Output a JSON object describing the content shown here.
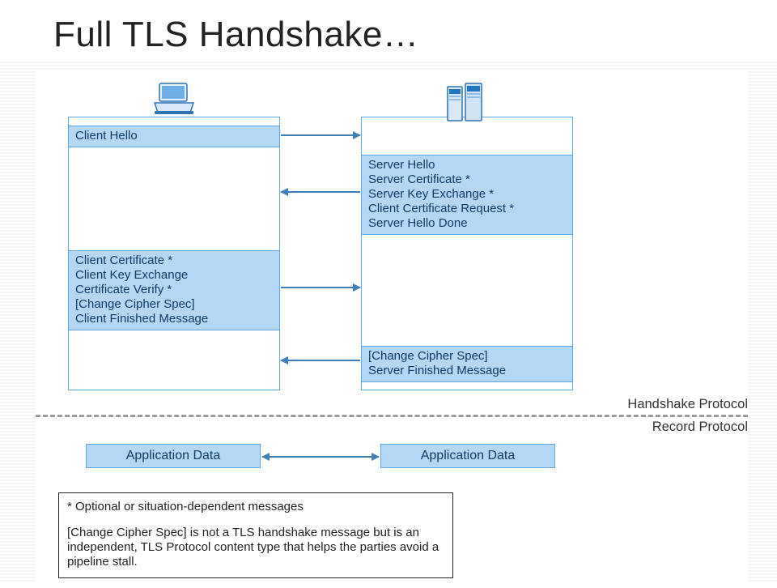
{
  "title": "Full TLS Handshake…",
  "client": {
    "icon": "laptop-icon",
    "step1": [
      "Client Hello"
    ],
    "step3": [
      "Client Certificate *",
      "Client Key Exchange",
      "Certificate Verify *",
      "[Change Cipher Spec]",
      "Client Finished Message"
    ]
  },
  "server": {
    "icon": "server-icon",
    "step2": [
      "Server Hello",
      "Server Certificate *",
      "Server Key Exchange *",
      "Client Certificate Request *",
      "Server Hello Done"
    ],
    "step4": [
      "[Change Cipher Spec]",
      "Server Finished Message"
    ]
  },
  "protocol": {
    "handshake": "Handshake Protocol",
    "record": "Record Protocol"
  },
  "appdata": {
    "client": "Application Data",
    "server": "Application Data"
  },
  "footnote": {
    "line1": "* Optional or situation-dependent messages",
    "line2": "[Change Cipher Spec] is not a TLS handshake message but is an independent, TLS Protocol content type that helps the parties avoid a pipeline stall."
  }
}
